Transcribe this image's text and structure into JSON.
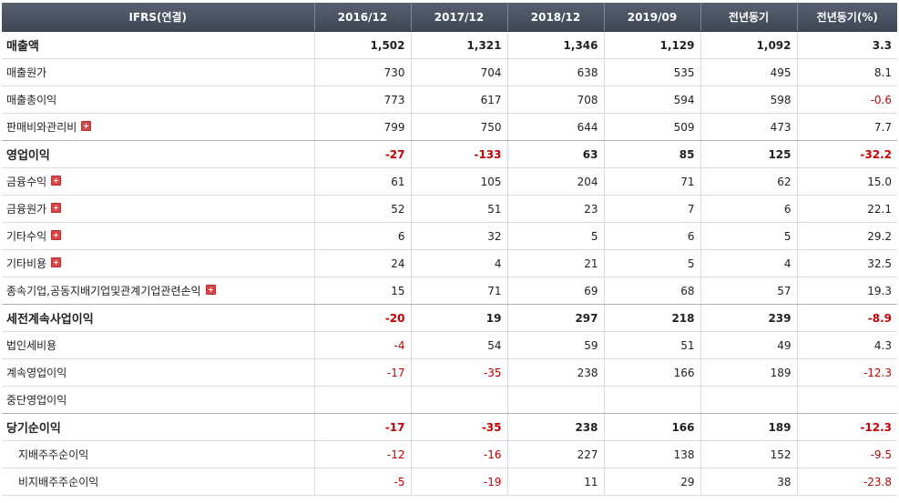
{
  "header": {
    "label": "IFRS(연결)",
    "periods": [
      "2016/12",
      "2017/12",
      "2018/12",
      "2019/09",
      "전년동기",
      "전년동기(%)"
    ]
  },
  "rows": [
    {
      "label": "매출액",
      "values": [
        "1,502",
        "1,321",
        "1,346",
        "1,129",
        "1,092",
        "3.3"
      ],
      "bold": true,
      "expandable": false
    },
    {
      "label": "매출원가",
      "values": [
        "730",
        "704",
        "638",
        "535",
        "495",
        "8.1"
      ],
      "bold": false,
      "expandable": false
    },
    {
      "label": "매출총이익",
      "values": [
        "773",
        "617",
        "708",
        "594",
        "598",
        "-0.6"
      ],
      "bold": false,
      "expandable": false
    },
    {
      "label": "판매비와관리비",
      "values": [
        "799",
        "750",
        "644",
        "509",
        "473",
        "7.7"
      ],
      "bold": false,
      "expandable": true
    },
    {
      "label": "영업이익",
      "values": [
        "-27",
        "-133",
        "63",
        "85",
        "125",
        "-32.2"
      ],
      "bold": true,
      "expandable": false
    },
    {
      "label": "금융수익",
      "values": [
        "61",
        "105",
        "204",
        "71",
        "62",
        "15.0"
      ],
      "bold": false,
      "expandable": true
    },
    {
      "label": "금융원가",
      "values": [
        "52",
        "51",
        "23",
        "7",
        "6",
        "22.1"
      ],
      "bold": false,
      "expandable": true
    },
    {
      "label": "기타수익",
      "values": [
        "6",
        "32",
        "5",
        "6",
        "5",
        "29.2"
      ],
      "bold": false,
      "expandable": true
    },
    {
      "label": "기타비용",
      "values": [
        "24",
        "4",
        "21",
        "5",
        "4",
        "32.5"
      ],
      "bold": false,
      "expandable": true
    },
    {
      "label": "종속기업,공동지배기업및관계기업관련손익",
      "values": [
        "15",
        "71",
        "69",
        "68",
        "57",
        "19.3"
      ],
      "bold": false,
      "expandable": true
    },
    {
      "label": "세전계속사업이익",
      "values": [
        "-20",
        "19",
        "297",
        "218",
        "239",
        "-8.9"
      ],
      "bold": true,
      "expandable": false
    },
    {
      "label": "법인세비용",
      "values": [
        "-4",
        "54",
        "59",
        "51",
        "49",
        "4.3"
      ],
      "bold": false,
      "expandable": false
    },
    {
      "label": "계속영업이익",
      "values": [
        "-17",
        "-35",
        "238",
        "166",
        "189",
        "-12.3"
      ],
      "bold": false,
      "expandable": false
    },
    {
      "label": "중단영업이익",
      "values": [
        "",
        "",
        "",
        "",
        "",
        ""
      ],
      "bold": false,
      "expandable": false
    },
    {
      "label": "당기순이익",
      "values": [
        "-17",
        "-35",
        "238",
        "166",
        "189",
        "-12.3"
      ],
      "bold": true,
      "expandable": false
    },
    {
      "label": "지배주주순이익",
      "values": [
        "-12",
        "-16",
        "227",
        "138",
        "152",
        "-9.5"
      ],
      "bold": false,
      "expandable": false,
      "indent": true
    },
    {
      "label": "비지배주주순이익",
      "values": [
        "-5",
        "-19",
        "11",
        "29",
        "38",
        "-23.8"
      ],
      "bold": false,
      "expandable": false,
      "indent": true
    }
  ],
  "colors": {
    "header_bg": "#46505e",
    "negative": "#c40000",
    "expand_icon": "#d64a4a"
  }
}
